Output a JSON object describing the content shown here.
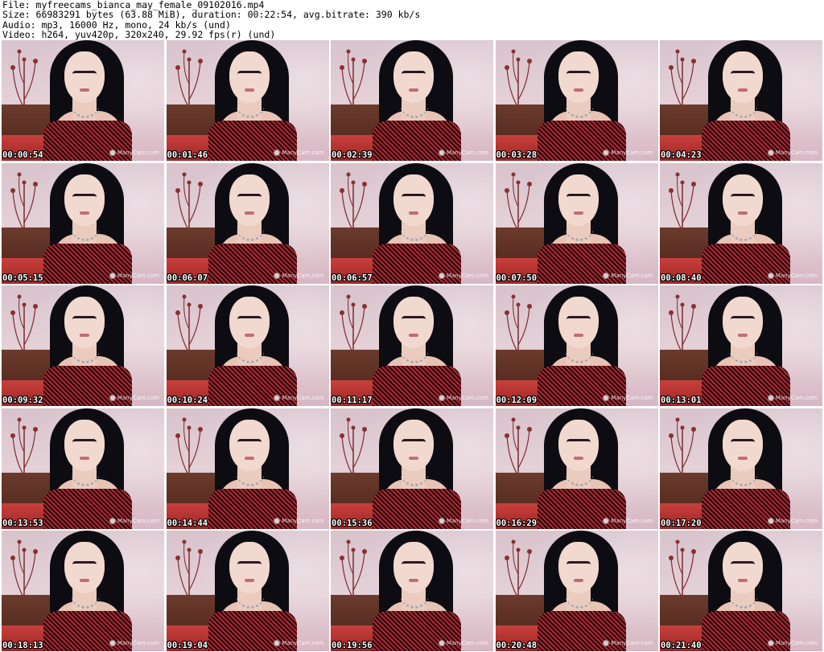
{
  "header": {
    "file": "File: myfreecams_bianca_may_female_09102016.mp4",
    "size": "Size: 66983291 bytes (63.88 MiB), duration: 00:22:54, avg.bitrate: 390 kb/s",
    "audio": "Audio: mp3, 16000 Hz, mono, 24 kb/s (und)",
    "video": "Video: h264, yuv420p, 320x240, 29.92 fps(r) (und)"
  },
  "watermark": "ManyCam.com",
  "thumbnails": [
    {
      "timestamp": "00:00:54"
    },
    {
      "timestamp": "00:01:46"
    },
    {
      "timestamp": "00:02:39"
    },
    {
      "timestamp": "00:03:28"
    },
    {
      "timestamp": "00:04:23"
    },
    {
      "timestamp": "00:05:15"
    },
    {
      "timestamp": "00:06:07"
    },
    {
      "timestamp": "00:06:57"
    },
    {
      "timestamp": "00:07:50"
    },
    {
      "timestamp": "00:08:40"
    },
    {
      "timestamp": "00:09:32"
    },
    {
      "timestamp": "00:10:24"
    },
    {
      "timestamp": "00:11:17"
    },
    {
      "timestamp": "00:12:09"
    },
    {
      "timestamp": "00:13:01"
    },
    {
      "timestamp": "00:13:53"
    },
    {
      "timestamp": "00:14:44"
    },
    {
      "timestamp": "00:15:36"
    },
    {
      "timestamp": "00:16:29"
    },
    {
      "timestamp": "00:17:20"
    },
    {
      "timestamp": "00:18:13"
    },
    {
      "timestamp": "00:19:04"
    },
    {
      "timestamp": "00:19:56"
    },
    {
      "timestamp": "00:20:48"
    },
    {
      "timestamp": "00:21:40"
    }
  ]
}
